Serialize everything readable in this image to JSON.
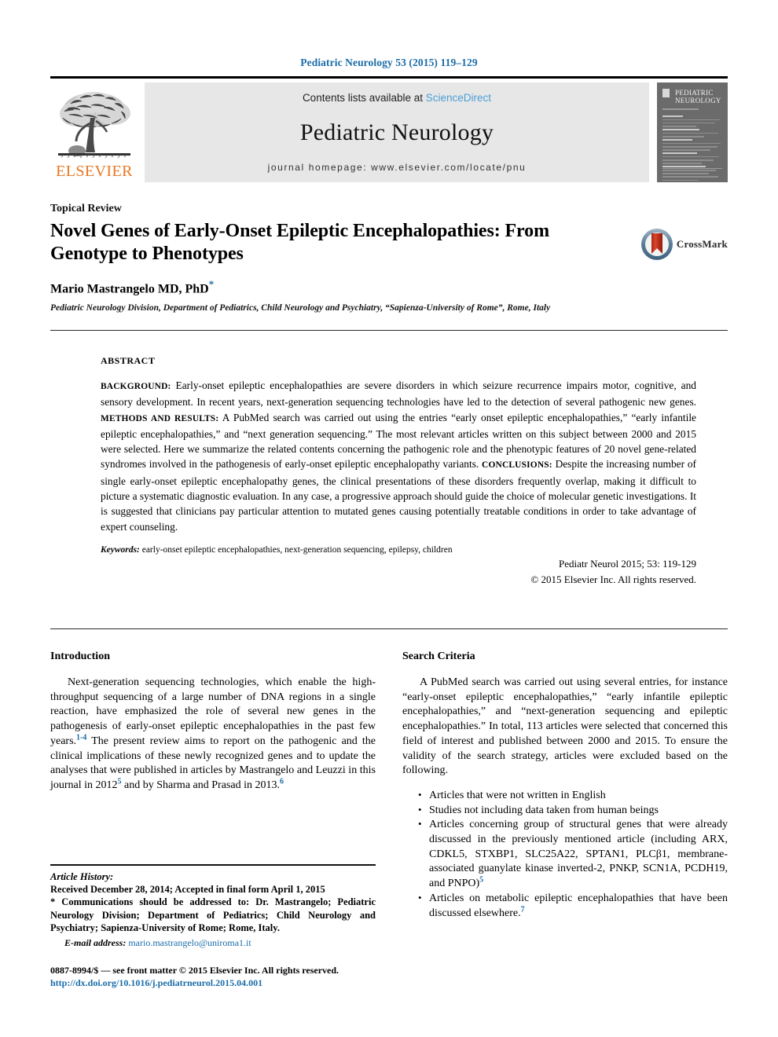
{
  "running_head": "Pediatric Neurology 53 (2015) 119–129",
  "masthead": {
    "contents_prefix": "Contents lists available at ",
    "sciencedirect": "ScienceDirect",
    "journal_name": "Pediatric Neurology",
    "homepage": "journal homepage: www.elsevier.com/locate/pnu",
    "publisher_logo_text": "ELSEVIER",
    "cover_title_line1": "PEDIATRIC",
    "cover_title_line2": "NEUROLOGY",
    "band_color": "#e7e7e7",
    "sciencedirect_color": "#4a9fd4",
    "elsevier_orange": "#E87722"
  },
  "title_block": {
    "kicker": "Topical Review",
    "title": "Novel Genes of Early-Onset Epileptic Encephalopathies: From Genotype to Phenotypes",
    "author": "Mario Mastrangelo MD, PhD",
    "author_marker": "*",
    "affiliation": "Pediatric Neurology Division, Department of Pediatrics, Child Neurology and Psychiatry, “Sapienza-University of Rome”, Rome, Italy",
    "crossmark_label": "CrossMark"
  },
  "abstract": {
    "label": "ABSTRACT",
    "background_label": "BACKGROUND:",
    "background_text": " Early-onset epileptic encephalopathies are severe disorders in which seizure recurrence impairs motor, cognitive, and sensory development. In recent years, next-generation sequencing technologies have led to the detection of several pathogenic new genes. ",
    "methods_label": "METHODS AND RESULTS:",
    "methods_text": " A PubMed search was carried out using the entries “early onset epileptic encephalopathies,” “early infantile epileptic encephalopathies,” and “next generation sequencing.” The most relevant articles written on this subject between 2000 and 2015 were selected. Here we summarize the related contents concerning the pathogenic role and the phenotypic features of 20 novel gene-related syndromes involved in the pathogenesis of early-onset epileptic encephalopathy variants. ",
    "conclusions_label": "CONCLUSIONS:",
    "conclusions_text": " Despite the increasing number of single early-onset epileptic encephalopathy genes, the clinical presentations of these disorders frequently overlap, making it difficult to picture a systematic diagnostic evaluation. In any case, a progressive approach should guide the choice of molecular genetic investigations. It is suggested that clinicians pay particular attention to mutated genes causing potentially treatable conditions in order to take advantage of expert counseling.",
    "keywords_label": "Keywords:",
    "keywords_text": " early-onset epileptic encephalopathies, next-generation sequencing, epilepsy, children",
    "citation": "Pediatr Neurol 2015; 53: 119-129",
    "rights": "© 2015 Elsevier Inc. All rights reserved."
  },
  "body": {
    "left_heading": "Introduction",
    "intro_part1": "Next-generation sequencing technologies, which enable the high-throughput sequencing of a large number of DNA regions in a single reaction, have emphasized the role of several new genes in the pathogenesis of early-onset epileptic encephalopathies in the past few years.",
    "intro_ref1": "1-4",
    "intro_part2": " The present review aims to report on the pathogenic and the clinical implications of these newly recognized genes and to update the analyses that were published in articles by Mastrangelo and Leuzzi in this journal in 2012",
    "intro_ref2": "5",
    "intro_part3": " and by Sharma and Prasad in 2013.",
    "intro_ref3": "6",
    "right_heading": "Search Criteria",
    "search_paragraph": "A PubMed search was carried out using several entries, for instance “early-onset epileptic encephalopathies,” “early infantile epileptic encephalopathies,” and “next-generation sequencing and epileptic encephalopathies.” In total, 113 articles were selected that concerned this field of interest and published between 2000 and 2015. To ensure the validity of the search strategy, articles were excluded based on the following.",
    "exclusions": [
      {
        "text": "Articles that were not written in English",
        "ref": ""
      },
      {
        "text": "Studies not including data taken from human beings",
        "ref": ""
      },
      {
        "text": "Articles concerning group of structural genes that were already discussed in the previously mentioned article (including ARX, CDKL5, STXBP1, SLC25A22, SPTAN1, PLCβ1, membrane-associated guanylate kinase inverted-2, PNKP, SCN1A, PCDH19, and PNPO)",
        "ref": "5"
      },
      {
        "text": "Articles on metabolic epileptic encephalopathies that have been discussed elsewhere.",
        "ref": "7"
      }
    ]
  },
  "footnote": {
    "history_label": "Article History:",
    "history_text": "Received December 28, 2014; Accepted in final form April 1, 2015",
    "correspondence": "* Communications should be addressed to: Dr. Mastrangelo; Pediatric Neurology Division; Department of Pediatrics; Child Neurology and Psychiatry; Sapienza-University of Rome; Rome, Italy.",
    "email_label": "E-mail address:",
    "email": "mario.mastrangelo@uniroma1.it",
    "issn_line": "0887-8994/$ — see front matter © 2015 Elsevier Inc. All rights reserved.",
    "doi": "http://dx.doi.org/10.1016/j.pediatrneurol.2015.04.001",
    "link_color": "#1a6ca8"
  }
}
